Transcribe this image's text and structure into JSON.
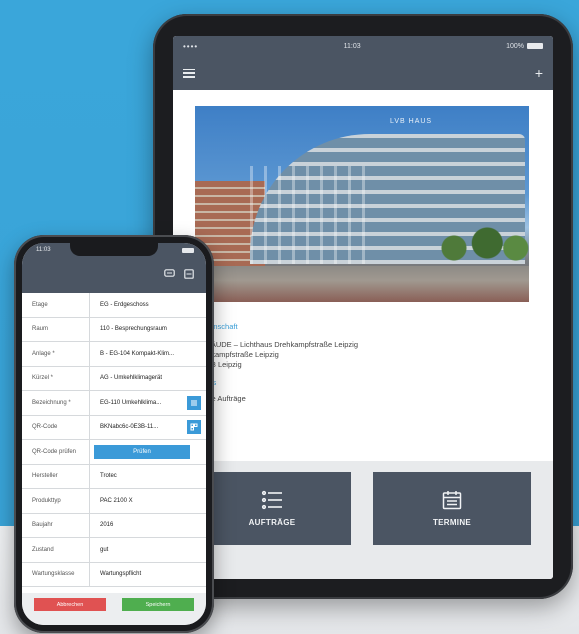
{
  "tablet": {
    "status": {
      "signal": "••••",
      "time": "11:03",
      "battery": "100%"
    },
    "nav": {
      "menu_icon": "hamburger-icon",
      "add_label": "+"
    },
    "photo": {
      "sign": "LVB HAUS"
    },
    "info": {
      "section1_header": "Liegenschaft",
      "line1": "GEBÄUDE – Lichthaus Drehkampfstraße Leipzig",
      "line2": "Drehkampfstraße Leipzig",
      "line3": "04133 Leipzig",
      "section2_header": "Status",
      "line4": "offene Aufträge"
    },
    "tiles": [
      {
        "label": "AUFTRÄGE",
        "icon": "list-icon"
      },
      {
        "label": "TERMINE",
        "icon": "calendar-icon"
      }
    ]
  },
  "phone": {
    "status": {
      "time": "11:03"
    },
    "header_icons": [
      "chat-icon",
      "document-icon"
    ],
    "rows": [
      {
        "label": "Etage",
        "value": "EG - Erdgeschoss"
      },
      {
        "label": "Raum",
        "value": "110 - Besprechungsraum"
      },
      {
        "label": "Anlage *",
        "value": "B - EG-104 Kompakt-Klim..."
      },
      {
        "label": "Kürzel *",
        "value": "AG - Umkehlklimagerät"
      },
      {
        "label": "Bezeichnung *",
        "value": "EG-110 Umkehlklima..."
      },
      {
        "label": "QR-Code",
        "value": "BKNabc6c-0E3B-11..."
      },
      {
        "label": "QR-Code prüfen",
        "value": "Prüfen"
      },
      {
        "label": "Hersteller",
        "value": "Trotec"
      },
      {
        "label": "Produkttyp",
        "value": "PAC 2100 X"
      },
      {
        "label": "Baujahr",
        "value": "2016"
      },
      {
        "label": "Zustand",
        "value": "gut"
      },
      {
        "label": "Wartungsklasse",
        "value": "Wartungspflicht"
      }
    ],
    "footer": {
      "cancel_label": "Abbrechen",
      "save_label": "Speichern"
    }
  },
  "colors": {
    "background": "#3aa6da",
    "header": "#4b5563",
    "accent": "#3b9ad8",
    "red": "#e05252",
    "green": "#4fae4f"
  }
}
